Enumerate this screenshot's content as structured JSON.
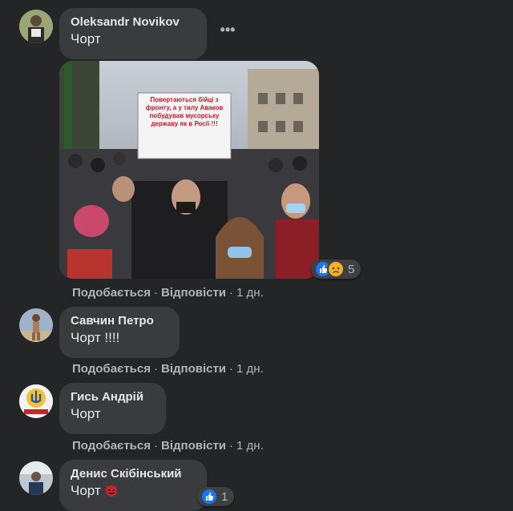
{
  "actions": {
    "like_label": "Подобається",
    "reply_label": "Відповісти",
    "separator": "·"
  },
  "comments": [
    {
      "author": "Oleksandr Novikov",
      "text": "Чорт",
      "time": "1 дн.",
      "photo_sign_text": "Повертаються бійці з фронту, а у тилу Аваков побудував мусорську державу як в Росії !!!",
      "reactions": {
        "icons": [
          "like-icon",
          "sad-icon"
        ],
        "count": "5"
      }
    },
    {
      "author": "Савчин Петро",
      "text": "Чорт !!!!",
      "time": "1 дн."
    },
    {
      "author": "Гись Андрій",
      "text": "Чорт",
      "time": "1 дн."
    },
    {
      "author": "Денис Скібінський",
      "text": "Чорт",
      "emoji": "devil-emoji",
      "reactions": {
        "icons": [
          "like-icon"
        ],
        "count": "1"
      }
    }
  ],
  "colors": {
    "background": "#242526",
    "bubble": "#3a3b3c",
    "like_blue": "#1877f2",
    "sad_yellow": "#f7b125",
    "devil_red": "#c0272d"
  }
}
